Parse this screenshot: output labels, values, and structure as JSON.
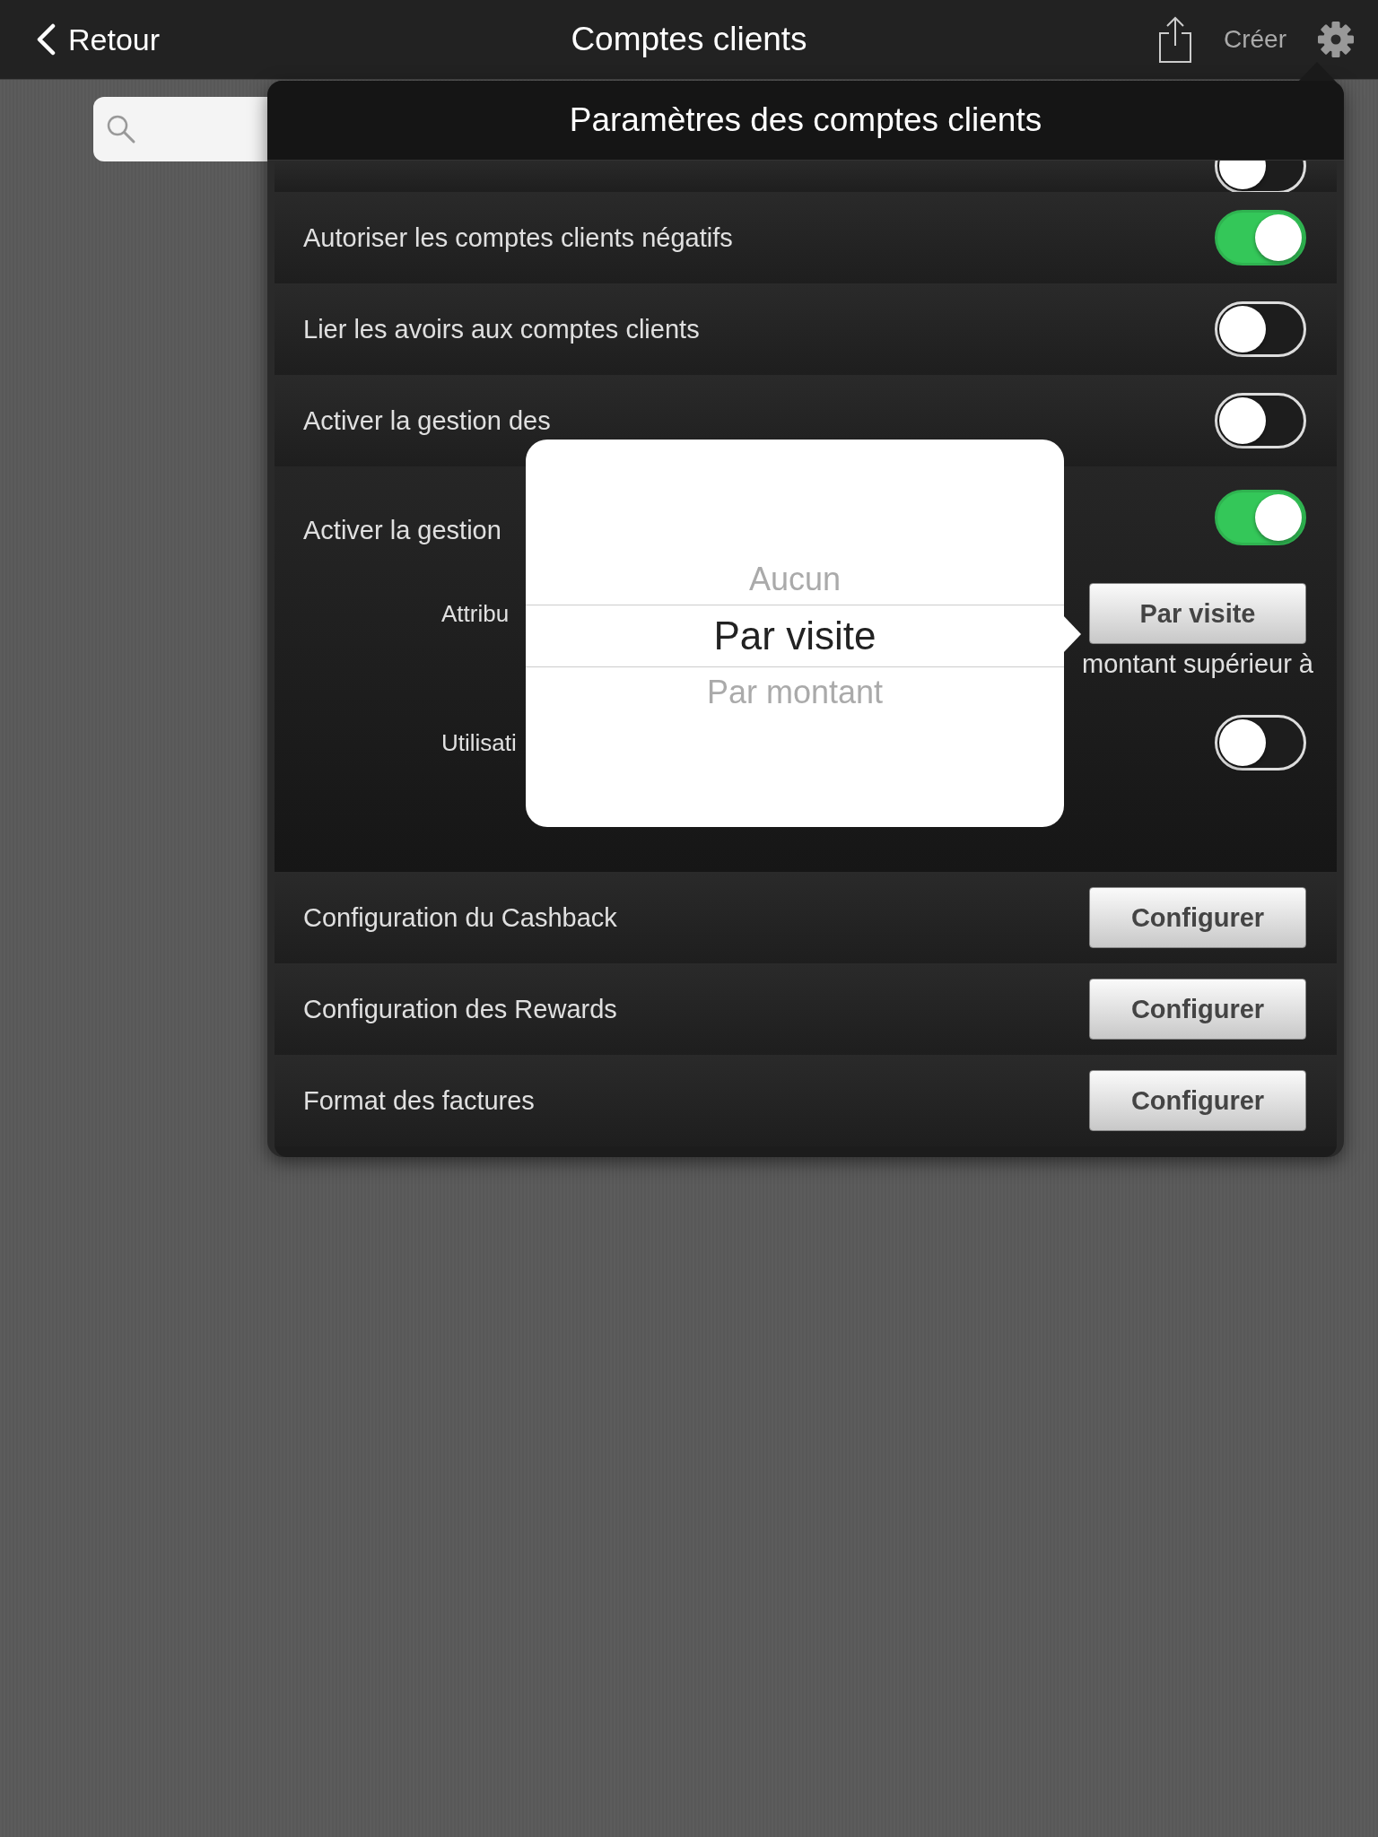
{
  "nav_bar": {
    "back": "Retour",
    "title": "Comptes clients",
    "create": "Créer"
  },
  "settings_popover": {
    "title": "Paramètres des comptes clients",
    "partial_row": {
      "on": false
    },
    "rows": [
      {
        "kind": "toggle",
        "label": "Autoriser les comptes clients négatifs",
        "on": true
      },
      {
        "kind": "toggle",
        "label": "Lier les avoirs aux comptes clients",
        "on": false
      },
      {
        "kind": "toggle",
        "label": "Activer la gestion des",
        "on": false
      },
      {
        "kind": "section",
        "label": "Activer la gestion",
        "on": true,
        "items": [
          {
            "kind": "select",
            "label": "Attribu",
            "value": "Par visite"
          },
          {
            "kind": "note",
            "label": "montant supérieur à"
          },
          {
            "kind": "toggle",
            "label": "Utilisati",
            "on": false
          }
        ]
      },
      {
        "kind": "button",
        "label": "Configuration du Cashback",
        "button": "Configurer"
      },
      {
        "kind": "button",
        "label": "Configuration des Rewards",
        "button": "Configurer"
      },
      {
        "kind": "button",
        "label": "Format des factures",
        "button": "Configurer"
      }
    ]
  },
  "picker": {
    "options": [
      {
        "label": "Aucun",
        "selected": false
      },
      {
        "label": "Par visite",
        "selected": true
      },
      {
        "label": "Par montant",
        "selected": false
      }
    ]
  }
}
